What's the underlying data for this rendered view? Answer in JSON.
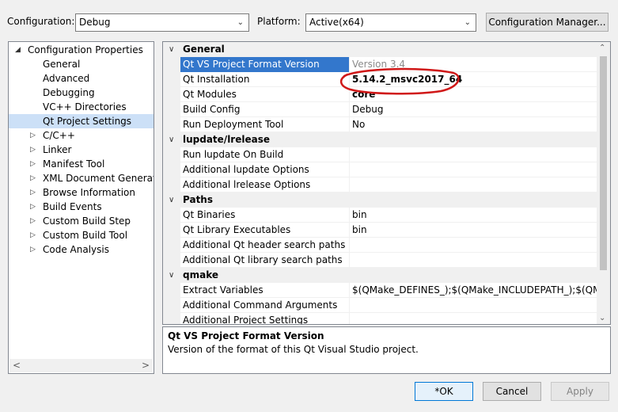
{
  "toolbar": {
    "configuration_label": "Configuration:",
    "configuration_value": "Debug",
    "platform_label": "Platform:",
    "platform_value": "Active(x64)",
    "config_manager_label": "Configuration Manager..."
  },
  "tree": {
    "root": "Configuration Properties",
    "items": [
      {
        "label": "General",
        "expandable": false
      },
      {
        "label": "Advanced",
        "expandable": false
      },
      {
        "label": "Debugging",
        "expandable": false
      },
      {
        "label": "VC++ Directories",
        "expandable": false
      },
      {
        "label": "Qt Project Settings",
        "expandable": false,
        "selected": true
      },
      {
        "label": "C/C++",
        "expandable": true
      },
      {
        "label": "Linker",
        "expandable": true
      },
      {
        "label": "Manifest Tool",
        "expandable": true
      },
      {
        "label": "XML Document Generator",
        "expandable": true
      },
      {
        "label": "Browse Information",
        "expandable": true
      },
      {
        "label": "Build Events",
        "expandable": true
      },
      {
        "label": "Custom Build Step",
        "expandable": true
      },
      {
        "label": "Custom Build Tool",
        "expandable": true
      },
      {
        "label": "Code Analysis",
        "expandable": true
      }
    ]
  },
  "grid": {
    "rows": [
      {
        "type": "category",
        "name": "General"
      },
      {
        "type": "prop",
        "name": "Qt VS Project Format Version",
        "value": "Version 3.4",
        "selected": true,
        "value_style": "grey"
      },
      {
        "type": "prop",
        "name": "Qt Installation",
        "value": "5.14.2_msvc2017_64",
        "value_style": "bold"
      },
      {
        "type": "prop",
        "name": "Qt Modules",
        "value": "core",
        "value_style": "bold"
      },
      {
        "type": "prop",
        "name": "Build Config",
        "value": "Debug"
      },
      {
        "type": "prop",
        "name": "Run Deployment Tool",
        "value": "No"
      },
      {
        "type": "category",
        "name": "lupdate/lrelease"
      },
      {
        "type": "prop",
        "name": "Run lupdate On Build",
        "value": ""
      },
      {
        "type": "prop",
        "name": "Additional lupdate Options",
        "value": ""
      },
      {
        "type": "prop",
        "name": "Additional lrelease Options",
        "value": ""
      },
      {
        "type": "category",
        "name": "Paths"
      },
      {
        "type": "prop",
        "name": "Qt Binaries",
        "value": "bin"
      },
      {
        "type": "prop",
        "name": "Qt Library Executables",
        "value": "bin"
      },
      {
        "type": "prop",
        "name": "Additional Qt header search paths",
        "value": ""
      },
      {
        "type": "prop",
        "name": "Additional Qt library search paths",
        "value": ""
      },
      {
        "type": "category",
        "name": "qmake"
      },
      {
        "type": "prop",
        "name": "Extract Variables",
        "value": "$(QMake_DEFINES_);$(QMake_INCLUDEPATH_);$(QMake_L"
      },
      {
        "type": "prop",
        "name": "Additional Command Arguments",
        "value": ""
      },
      {
        "type": "prop",
        "name": "Additional Project Settings",
        "value": ""
      }
    ]
  },
  "description": {
    "title": "Qt VS Project Format Version",
    "text": "Version of the format of this Qt Visual Studio project."
  },
  "buttons": {
    "ok": "*OK",
    "cancel": "Cancel",
    "apply": "Apply"
  },
  "colors": {
    "selection": "#3377cc",
    "tree_selection": "#cce0f7",
    "annotation": "#d01818"
  }
}
